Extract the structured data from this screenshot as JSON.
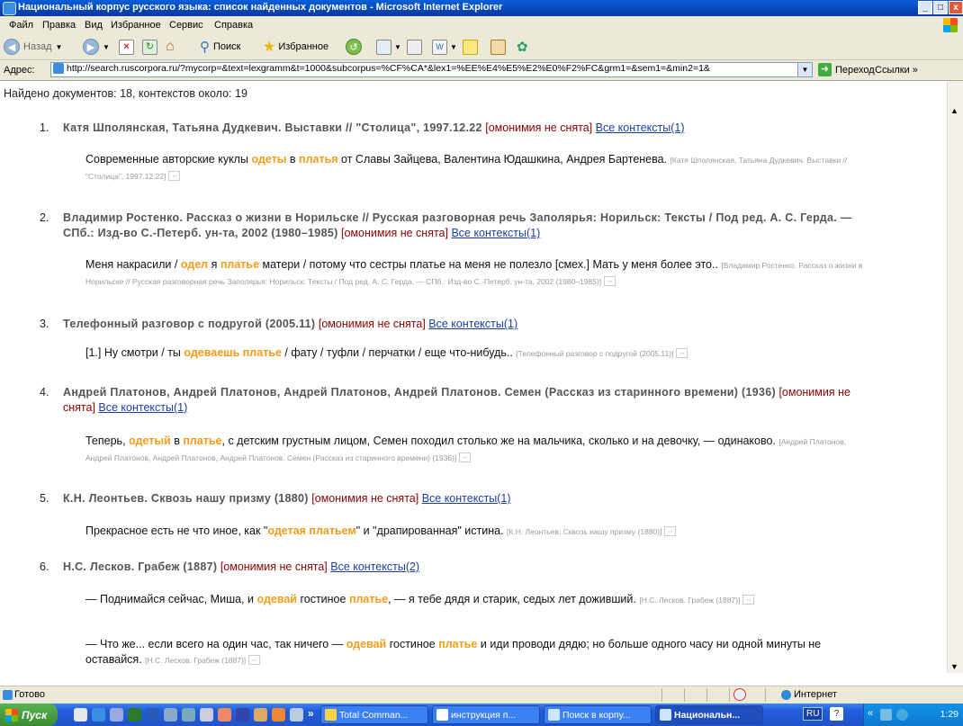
{
  "window": {
    "title": "Национальный корпус русского языка: список найденных документов - Microsoft Internet Explorer",
    "min_label": "_",
    "max_label": "□",
    "close_label": "x"
  },
  "menu": [
    "Файл",
    "Правка",
    "Вид",
    "Избранное",
    "Сервис",
    "Справка"
  ],
  "toolbar": {
    "back_label": "Назад",
    "search_label": "Поиск",
    "favorites_label": "Избранное"
  },
  "address": {
    "label": "Адрес:",
    "url": "http://search.ruscorpora.ru/?mycorp=&text=lexgramm&t=1000&subcorpus=%CF%CA*&lex1=%EE%E4%E5%E2%E0%F2%FC&grm1=&sem1=&min2=1&",
    "go_label": "Переход",
    "links_label": "Ссылки »"
  },
  "results": {
    "summary": "Найдено документов: 18, контекстов около: 19",
    "homonymy": "[омонимия не снята]",
    "documents": [
      {
        "num": "1.",
        "title": "Катя Шполянская, Татьяна Дудкевич. Выставки // \"Столица\", 1997.12.22",
        "all_contexts": "Все контексты(1)",
        "snippets": [
          {
            "pre": "Современные авторские куклы ",
            "w1": "одеты",
            "mid": " в ",
            "w2": "платья",
            "post": " от Славы Зайцева, Валентина Юдашкина, Андрея Бартенева. ",
            "src": "[Катя Шполянская, Татьяна Дудкевич. Выставки // \"Столица\", 1997.12.22]"
          }
        ]
      },
      {
        "num": "2.",
        "title": "Владимир Ростенко. Рассказ о жизни в Норильске // Русская разговорная речь Заполярья: Норильск: Тексты / Под ред. А. С. Герда. — СПб.: Изд-во С.-Петерб. ун-та, 2002 (1980–1985)",
        "all_contexts": "Все контексты(1)",
        "snippets": [
          {
            "pre": "Меня накрасили / ",
            "w1": "одел",
            "mid": " я ",
            "w2": "платье",
            "post": " матери / потому что сестры платье на меня не полезло [смех.] Мать у меня более это.. ",
            "src": "[Владимир Ростенко. Рассказ о жизни в Норильске // Русская разговорная речь Заполярья: Норильск: Тексты / Под ред. А. С. Герда. — СПб.: Изд-во С.-Петерб. ун-та, 2002 (1980–1985)]"
          }
        ]
      },
      {
        "num": "3.",
        "title": "Телефонный разговор с подругой (2005.11)",
        "all_contexts": "Все контексты(1)",
        "snippets": [
          {
            "pre": "[1.] Ну смотри / ты ",
            "w1": "одеваешь",
            "mid": " ",
            "w2": "платье",
            "post": " / фату / туфли / перчатки / еще что-нибудь.. ",
            "src": "[Телефонный разговор с подругой (2005.11)]"
          }
        ]
      },
      {
        "num": "4.",
        "title": "Андрей Платонов, Андрей Платонов, Андрей Платонов, Андрей Платонов. Семен (Рассказ из старинного времени) (1936)",
        "all_contexts": "Все контексты(1)",
        "snippets": [
          {
            "pre": "Теперь, ",
            "w1": "одетый",
            "mid": " в ",
            "w2": "платье",
            "post": ", с детским грустным лицом, Семен походил столько же на мальчика, сколько и на девочку, — одинаково. ",
            "src": "[Андрей Платонов, Андрей Платонов, Андрей Платонов, Андрей Платонов. Семен (Рассказ из старинного времени) (1936)]"
          }
        ]
      },
      {
        "num": "5.",
        "title": "К.Н. Леонтьев. Сквозь нашу призму (1880)",
        "all_contexts": "Все контексты(1)",
        "snippets": [
          {
            "pre": "Прекрасное есть не что иное, как \"",
            "w1": "одетая",
            "mid": " ",
            "w2": "платьем",
            "post": "\" и \"драпированная\" истина. ",
            "src": "[К.Н. Леонтьев. Сквозь нашу призму (1880)]"
          }
        ]
      },
      {
        "num": "6.",
        "title": "Н.С. Лесков. Грабеж (1887)",
        "all_contexts": "Все контексты(2)",
        "snippets": [
          {
            "pre": "— Поднимайся сейчас, Миша, и ",
            "w1": "одевай",
            "mid": " гостиное ",
            "w2": "платье",
            "post": ", — я тебе дядя и старик, седых лет доживший. ",
            "src": "[Н.С. Лесков. Грабеж (1887)]"
          },
          {
            "pre": "— Что же... если всего на один час, так ничего — ",
            "w1": "одевай",
            "mid": " гостиное ",
            "w2": "платье",
            "post": " и иди проводи дядю; но больше одного часу ни одной минуты не оставайся. ",
            "src": "[Н.С. Лесков. Грабеж (1887)]"
          }
        ]
      }
    ]
  },
  "status": {
    "text": "Готово",
    "zone": "Интернет"
  },
  "taskbar": {
    "start_label": "Пуск",
    "more_label": "»",
    "tasks": [
      {
        "label": "Total Comman..."
      },
      {
        "label": "инструкция п..."
      },
      {
        "label": "Поиск в корпу..."
      },
      {
        "label": "Национальн..."
      }
    ],
    "lang": "RU",
    "clock": "1:29"
  },
  "colors": {
    "highlight": "#f39c1a",
    "homonymy": "#8b0000",
    "link": "#1a3fa8",
    "titlebar": "#0a5fd8"
  }
}
